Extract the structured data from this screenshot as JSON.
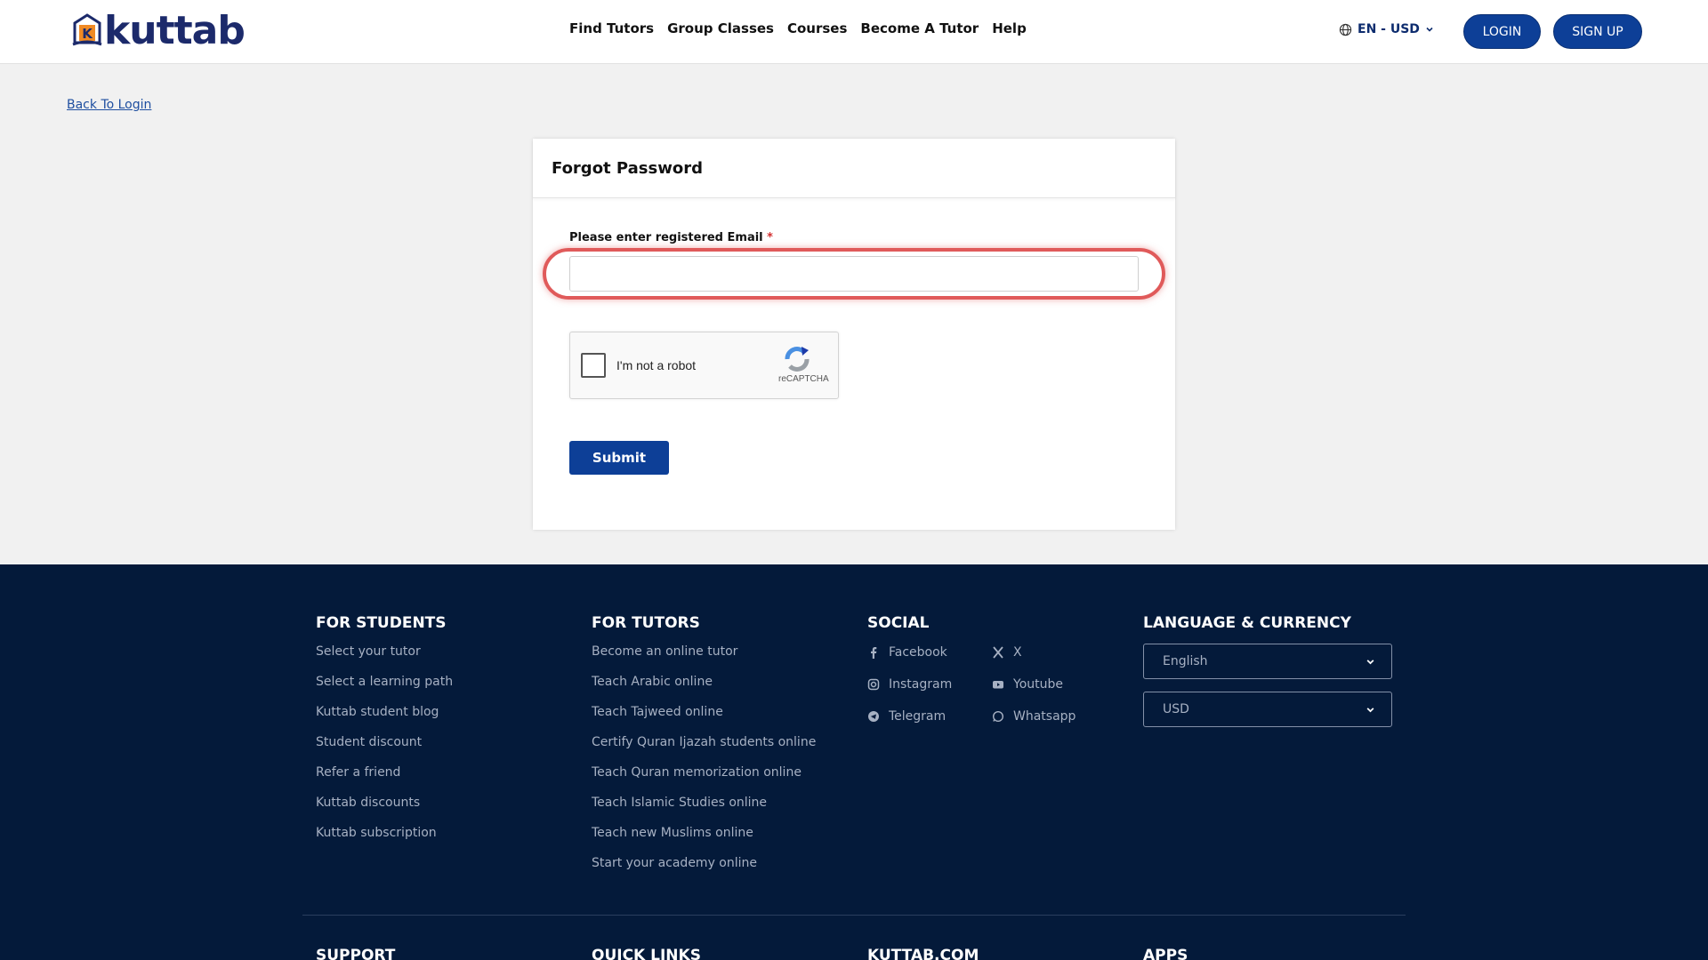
{
  "header": {
    "logo_text": "kuttab",
    "nav": [
      "Find Tutors",
      "Group Classes",
      "Courses",
      "Become A Tutor",
      "Help"
    ],
    "lang_label": "EN - USD",
    "login_label": "LOGIN",
    "signup_label": "SIGN UP"
  },
  "main": {
    "back_label": "Back To Login",
    "card_title": "Forgot Password",
    "email_label": "Please enter registered Email",
    "required_mark": "*",
    "email_value": "",
    "captcha_label": "I'm not a robot",
    "captcha_brand": "reCAPTCHA",
    "submit_label": "Submit"
  },
  "footer": {
    "students": {
      "title": "FOR STUDENTS",
      "items": [
        "Select your tutor",
        "Select a learning path",
        "Kuttab student blog",
        "Student discount",
        "Refer a friend",
        "Kuttab discounts",
        "Kuttab subscription"
      ]
    },
    "tutors": {
      "title": "FOR TUTORS",
      "items": [
        "Become an online tutor",
        "Teach Arabic online",
        "Teach Tajweed online",
        "Certify Quran Ijazah students online",
        "Teach Quran memorization online",
        "Teach Islamic Studies online",
        "Teach new Muslims online",
        "Start your academy online"
      ]
    },
    "social": {
      "title": "SOCIAL",
      "items": [
        {
          "label": "Facebook",
          "icon": "facebook-icon"
        },
        {
          "label": "X",
          "icon": "x-icon"
        },
        {
          "label": "Instagram",
          "icon": "instagram-icon"
        },
        {
          "label": "Youtube",
          "icon": "youtube-icon"
        },
        {
          "label": "Telegram",
          "icon": "telegram-icon"
        },
        {
          "label": "Whatsapp",
          "icon": "whatsapp-icon"
        }
      ]
    },
    "lang_currency": {
      "title": "LANGUAGE & CURRENCY",
      "language": "English",
      "currency": "USD"
    },
    "bottom_titles": [
      "SUPPORT",
      "QUICK LINKS",
      "KUTTAB.COM",
      "APPS"
    ]
  },
  "colors": {
    "brand": "#0d3f97",
    "footer_bg": "#041a3a",
    "highlight": "#e05a5a"
  }
}
